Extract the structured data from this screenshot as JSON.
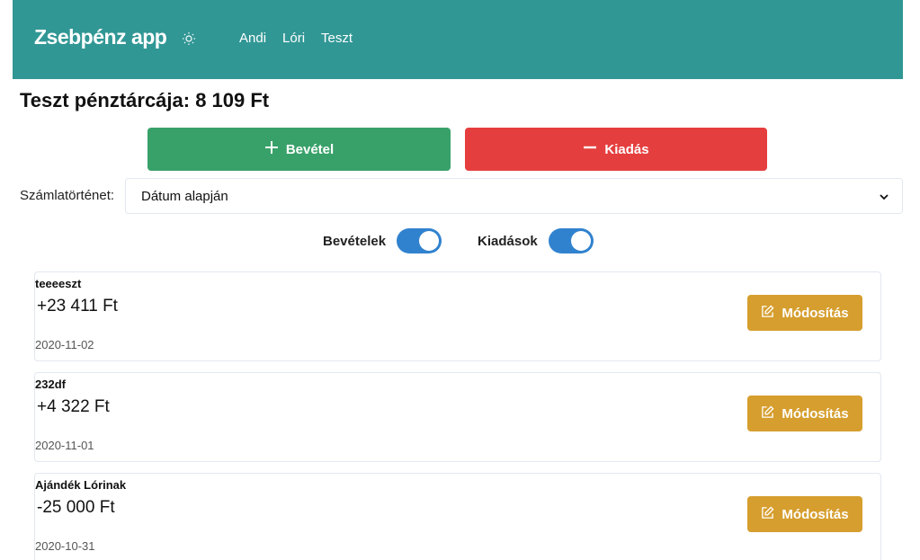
{
  "header": {
    "brand": "Zsebpénz app",
    "theme_icon": "sun-icon",
    "nav": [
      {
        "label": "Andi"
      },
      {
        "label": "Lóri"
      },
      {
        "label": "Teszt"
      }
    ],
    "background_color": "#319795"
  },
  "wallet": {
    "title": "Teszt pénztárcája: 8 109 Ft"
  },
  "actions": {
    "income_label": "Bevétel",
    "income_icon": "plus-icon",
    "income_color": "#38a169",
    "expense_label": "Kiadás",
    "expense_icon": "minus-icon",
    "expense_color": "#e53e3e"
  },
  "history": {
    "label": "Számlatörténet:",
    "selected": "Dátum alapján"
  },
  "filters": {
    "income_label": "Bevételek",
    "income_on": true,
    "expense_label": "Kiadások",
    "expense_on": true,
    "switch_color": "#3182ce"
  },
  "transactions": [
    {
      "title": "teeeeszt",
      "amount": "+23 411 Ft",
      "date": "2020-11-02",
      "edit_label": "Módosítás"
    },
    {
      "title": "232df",
      "amount": "+4 322 Ft",
      "date": "2020-11-01",
      "edit_label": "Módosítás"
    },
    {
      "title": "Ajándék Lórinak",
      "amount": "-25 000 Ft",
      "date": "2020-10-31",
      "edit_label": "Módosítás"
    }
  ],
  "edit_button_color": "#d69e2e"
}
